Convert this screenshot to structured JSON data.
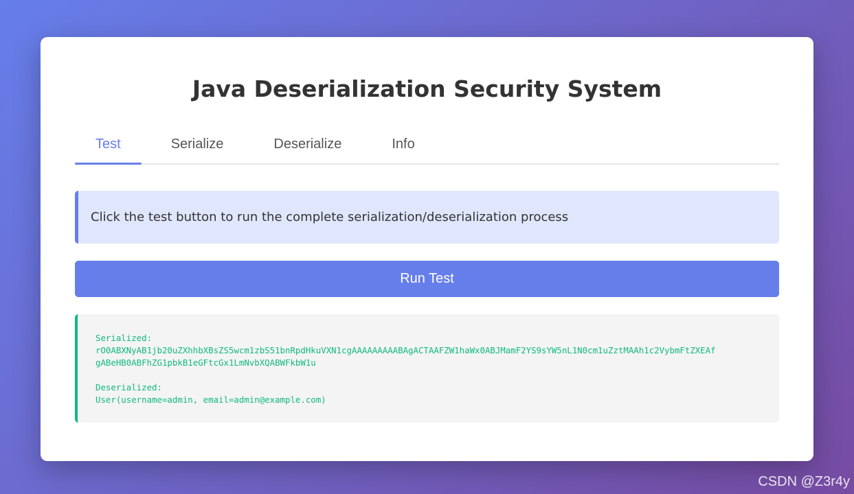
{
  "page": {
    "title": "Java Deserialization Security System"
  },
  "tabs": [
    {
      "label": "Test",
      "active": true
    },
    {
      "label": "Serialize",
      "active": false
    },
    {
      "label": "Deserialize",
      "active": false
    },
    {
      "label": "Info",
      "active": false
    }
  ],
  "info": {
    "message": "Click the test button to run the complete serialization/deserialization process"
  },
  "actions": {
    "run_label": "Run Test"
  },
  "result": {
    "serialized_label": "Serialized:",
    "serialized_line1": "rO0ABXNyAB1jb20uZXhhbXBsZS5wcm1zbS51bnRpdHkuVXN1cgAAAAAAAAABAgACTAAFZW1haWx0ABJMamF2YS9sYW5nL1N0cm1uZztMAAh1c2VybmFtZXEAf",
    "serialized_line2": "gABeHB0ABFhZG1pbkB1eGFtcGx1LmNvbXQABWFkbW1u",
    "deserialized_label": "Deserialized:",
    "deserialized_value": "User(username=admin, email=admin@example.com)"
  },
  "watermark": "CSDN @Z3r4y",
  "colors": {
    "accent": "#667eea",
    "success": "#10b981",
    "background_start": "#667eea",
    "background_end": "#764ba2"
  }
}
